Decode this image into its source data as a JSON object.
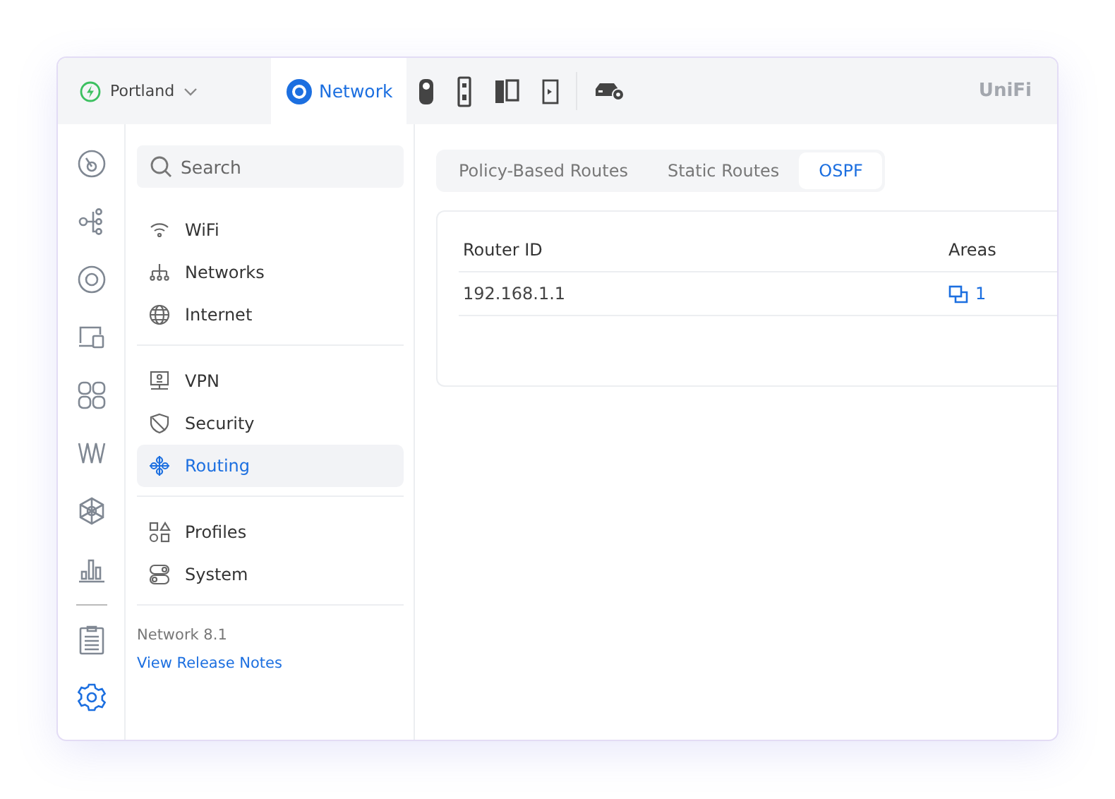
{
  "site": {
    "name": "Portland"
  },
  "apps": [
    {
      "kind": "network",
      "label": "Network",
      "selected": true
    },
    {
      "kind": "camera",
      "selected": false
    },
    {
      "kind": "doorbell",
      "selected": false
    },
    {
      "kind": "door",
      "selected": false
    },
    {
      "kind": "phone",
      "selected": false
    },
    {
      "kind": "gateway",
      "selected": false
    }
  ],
  "logo": "UniFi",
  "rail": [
    {
      "kind": "dashboard",
      "selected": false
    },
    {
      "kind": "topology",
      "selected": false
    },
    {
      "kind": "devices",
      "selected": false
    },
    {
      "kind": "clients",
      "selected": false
    },
    {
      "kind": "ports",
      "selected": false
    },
    {
      "kind": "insights",
      "selected": false
    },
    {
      "kind": "hub",
      "selected": false
    },
    {
      "kind": "stats",
      "selected": false
    },
    {
      "kind": "logs",
      "selected": false
    },
    {
      "kind": "settings",
      "selected": true
    }
  ],
  "search": {
    "placeholder": "Search"
  },
  "nav": [
    [
      {
        "kind": "wifi",
        "label": "WiFi",
        "selected": false
      },
      {
        "kind": "networks",
        "label": "Networks",
        "selected": false
      },
      {
        "kind": "internet",
        "label": "Internet",
        "selected": false
      }
    ],
    [
      {
        "kind": "vpn",
        "label": "VPN",
        "selected": false
      },
      {
        "kind": "security",
        "label": "Security",
        "selected": false
      },
      {
        "kind": "routing",
        "label": "Routing",
        "selected": true
      }
    ],
    [
      {
        "kind": "profiles",
        "label": "Profiles",
        "selected": false
      },
      {
        "kind": "system",
        "label": "System",
        "selected": false
      }
    ]
  ],
  "version": "Network 8.1",
  "release_link": "View Release Notes",
  "tabs": [
    {
      "label": "Policy-Based Routes",
      "selected": false
    },
    {
      "label": "Static Routes",
      "selected": false
    },
    {
      "label": "OSPF",
      "selected": true
    }
  ],
  "table": {
    "columns": [
      "Router ID",
      "Areas"
    ],
    "rows": [
      {
        "router_id": "192.168.1.1",
        "areas": "1"
      }
    ]
  }
}
